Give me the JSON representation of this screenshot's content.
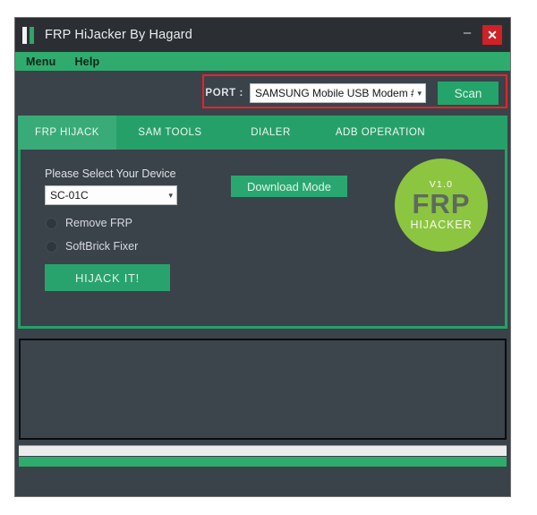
{
  "window": {
    "title": "FRP HiJacker By Hagard",
    "app_icon": "app-bars-icon",
    "minimize_label": "–",
    "close_label": "✕",
    "close_color": "#cf2127",
    "accent_green": "#2eab6d",
    "panel_dark": "#3a424a",
    "titlebar_dark": "#2b2f33"
  },
  "menu": {
    "items": [
      {
        "label": "Menu"
      },
      {
        "label": "Help"
      }
    ]
  },
  "port": {
    "label": "PORT :",
    "selected": "SAMSUNG Mobile USB Modem #",
    "placeholder": "SAMSUNG Mobile USB Modem #",
    "chevron": "▾",
    "scan_label": "Scan",
    "highlight_color": "#e8232a"
  },
  "tabs": [
    {
      "label": "FRP HIJACK",
      "active": true
    },
    {
      "label": "SAM TOOLS",
      "active": false
    },
    {
      "label": "DIALER",
      "active": false
    },
    {
      "label": "ADB OPERATION",
      "active": false
    }
  ],
  "frp_panel": {
    "device_label": "Please Select Your Device",
    "device_selected": "SC-01C",
    "device_chevron": "▾",
    "download_mode_label": "Download Mode",
    "options": [
      {
        "label": "Remove FRP",
        "selected": false
      },
      {
        "label": "SoftBrick Fixer",
        "selected": false
      }
    ],
    "hijack_label": "HIJACK IT!"
  },
  "logo": {
    "version": "V1.0",
    "main": "FRP",
    "sub": "HIJACKER",
    "circle_color": "#8cc540"
  },
  "log": {
    "content": ""
  }
}
